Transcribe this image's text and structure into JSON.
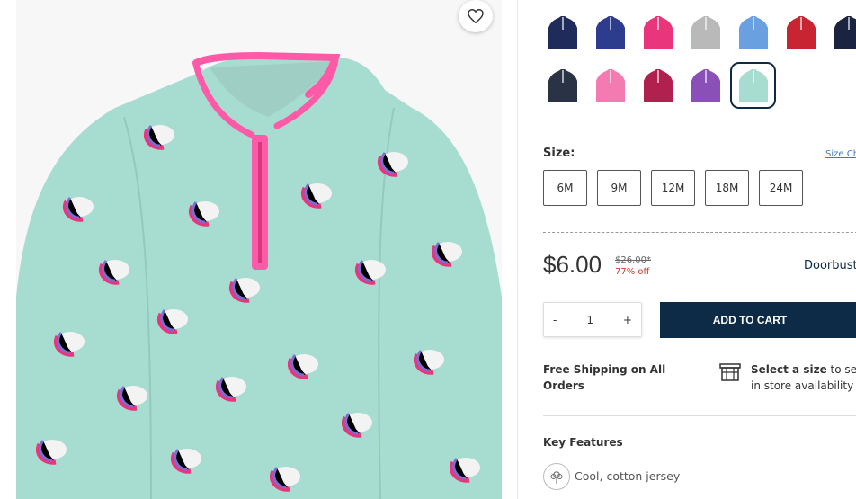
{
  "product_image": {
    "alt_colors": {
      "body": "#a7dcd0",
      "trim": "#ff5aa8"
    }
  },
  "favorite": {
    "icon": "heart-icon"
  },
  "swatches": {
    "row1": [
      {
        "name": "navy-pattern-1",
        "color": "#1f2b5a"
      },
      {
        "name": "navy-pattern-2",
        "color": "#2d3c8c"
      },
      {
        "name": "pink-colorblock",
        "color": "#e8357c"
      },
      {
        "name": "grey-print",
        "color": "#b9b9b9"
      },
      {
        "name": "stripe-multi",
        "color": "#6a9fe0"
      },
      {
        "name": "red-fairisle",
        "color": "#c82432"
      },
      {
        "name": "navy-dots",
        "color": "#1a2440"
      }
    ],
    "row2": [
      {
        "name": "navy-stripe",
        "color": "#2a3246"
      },
      {
        "name": "pink-solid",
        "color": "#f47bb2"
      },
      {
        "name": "berry-hearts",
        "color": "#b0214f"
      },
      {
        "name": "purple-colorblock",
        "color": "#8b4fb8"
      },
      {
        "name": "mint-unicorn",
        "color": "#a7dcd0",
        "selected": true
      }
    ]
  },
  "size": {
    "label": "Size:",
    "chart_link": "Size Chart",
    "options": [
      "6M",
      "9M",
      "12M",
      "18M",
      "24M"
    ]
  },
  "pricing": {
    "price": "$6.00",
    "original": "$26.00*",
    "discount": "77% off",
    "badge": "Doorbuster"
  },
  "quantity": {
    "minus": "-",
    "value": "1",
    "plus": "+"
  },
  "cart": {
    "label": "ADD TO CART"
  },
  "shipping": {
    "text": "Free Shipping on All Orders"
  },
  "store": {
    "bold": "Select a size",
    "rest_line1": " to see",
    "line2": "in store availability",
    "icon": "store-icon"
  },
  "features": {
    "title": "Key Features",
    "items": [
      {
        "icon": "cotton-icon",
        "text": "Cool, cotton jersey"
      }
    ]
  },
  "colors": {
    "navy": "#0d2a46",
    "sale_red": "#d43a2a",
    "link_blue": "#3b7bbf"
  }
}
